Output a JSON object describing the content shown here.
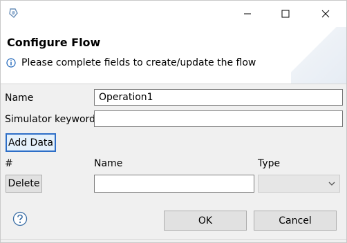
{
  "dialog": {
    "title": "Configure Flow",
    "message": "Please complete fields to create/update the flow"
  },
  "fields": {
    "name_label": "Name",
    "name_value": "Operation1",
    "keyword_label": "Simulator keyword",
    "keyword_value": ""
  },
  "data_section": {
    "add_data_label": "Add Data",
    "col_index": "#",
    "col_name": "Name",
    "col_type": "Type",
    "delete_label": "Delete",
    "row_name_value": "",
    "row_type_value": ""
  },
  "footer": {
    "ok_label": "OK",
    "cancel_label": "Cancel"
  },
  "icons": {
    "app": "app-icon",
    "info": "info-icon",
    "help": "help-icon",
    "minimize": "minimize-icon",
    "maximize": "maximize-icon",
    "close": "close-icon"
  },
  "colors": {
    "focus_border": "#2d6ec7",
    "info_blue": "#1a62b8"
  }
}
